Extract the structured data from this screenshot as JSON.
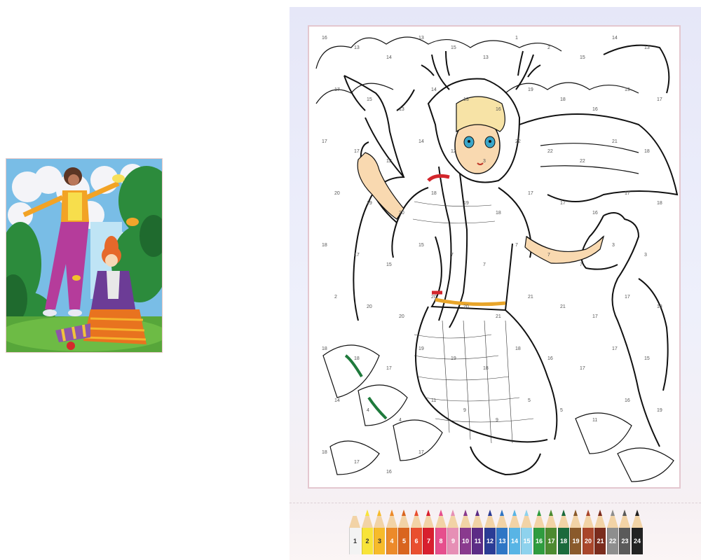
{
  "reference": {
    "description_visible": false
  },
  "coloring_page": {
    "numbers": [
      "16",
      "13",
      "14",
      "13",
      "15",
      "13",
      "1",
      "2",
      "15",
      "14",
      "13",
      "17",
      "15",
      "13",
      "14",
      "13",
      "16",
      "19",
      "18",
      "16",
      "19",
      "17",
      "17",
      "17",
      "12",
      "14",
      "12",
      "3",
      "22",
      "22",
      "22",
      "21",
      "18",
      "20",
      "19",
      "20",
      "18",
      "19",
      "18",
      "17",
      "17",
      "16",
      "17",
      "18",
      "18",
      "17",
      "15",
      "15",
      "7",
      "7",
      "7",
      "7",
      "7",
      "3",
      "3",
      "2",
      "20",
      "20",
      "20",
      "20",
      "21",
      "21",
      "21",
      "17",
      "17",
      "18",
      "18",
      "18",
      "17",
      "19",
      "19",
      "18",
      "18",
      "16",
      "17",
      "17",
      "15",
      "14",
      "4",
      "4",
      "11",
      "9",
      "9",
      "5",
      "5",
      "11",
      "16",
      "19",
      "18",
      "17",
      "16",
      "17"
    ]
  },
  "palette": {
    "pencils": [
      {
        "number": "1",
        "color": "#f3f3f3",
        "dark_label": true
      },
      {
        "number": "2",
        "color": "#f8e43a",
        "dark_label": true
      },
      {
        "number": "3",
        "color": "#f7bb2a",
        "dark_label": true
      },
      {
        "number": "4",
        "color": "#ec8a2a",
        "dark_label": false
      },
      {
        "number": "5",
        "color": "#d9651f",
        "dark_label": false
      },
      {
        "number": "6",
        "color": "#e94e2f",
        "dark_label": false
      },
      {
        "number": "7",
        "color": "#d81f2e",
        "dark_label": false
      },
      {
        "number": "8",
        "color": "#e64f8d",
        "dark_label": false
      },
      {
        "number": "9",
        "color": "#e68fb5",
        "dark_label": false
      },
      {
        "number": "10",
        "color": "#8a3a8e",
        "dark_label": false
      },
      {
        "number": "11",
        "color": "#5c2c86",
        "dark_label": false
      },
      {
        "number": "12",
        "color": "#2b3c95",
        "dark_label": false
      },
      {
        "number": "13",
        "color": "#2f76c5",
        "dark_label": false
      },
      {
        "number": "14",
        "color": "#58b4e5",
        "dark_label": false
      },
      {
        "number": "15",
        "color": "#8ed2ed",
        "dark_label": false
      },
      {
        "number": "16",
        "color": "#2f9c3f",
        "dark_label": false
      },
      {
        "number": "17",
        "color": "#4c8a30",
        "dark_label": false
      },
      {
        "number": "18",
        "color": "#1b6a3c",
        "dark_label": false
      },
      {
        "number": "19",
        "color": "#8a5a2b",
        "dark_label": false
      },
      {
        "number": "20",
        "color": "#a9462b",
        "dark_label": false
      },
      {
        "number": "21",
        "color": "#7b2c1d",
        "dark_label": false
      },
      {
        "number": "22",
        "color": "#8e8e8e",
        "dark_label": false
      },
      {
        "number": "23",
        "color": "#5a5a5a",
        "dark_label": false
      },
      {
        "number": "24",
        "color": "#222222",
        "dark_label": false
      }
    ]
  }
}
